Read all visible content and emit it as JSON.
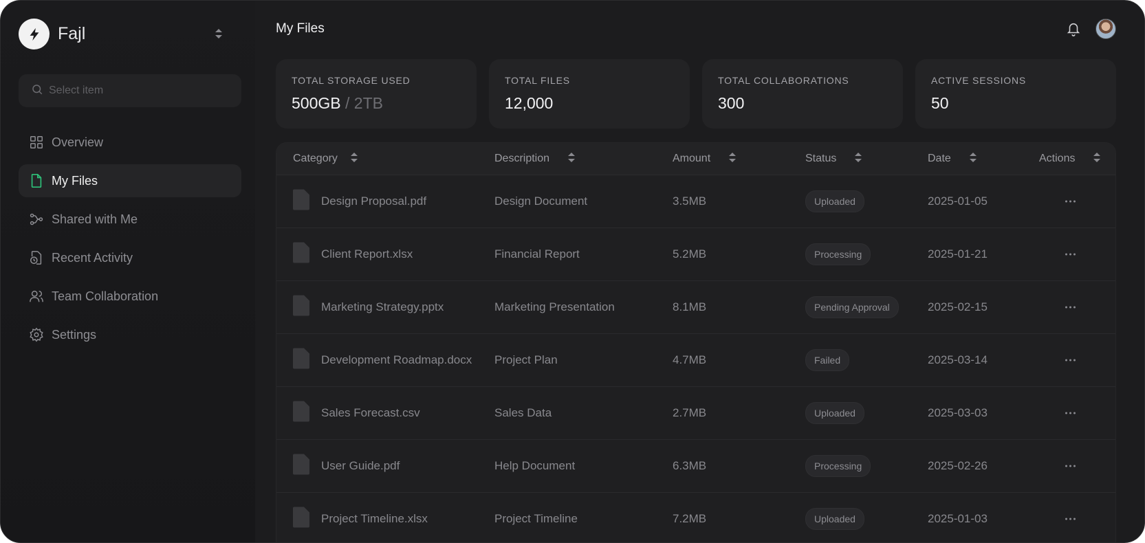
{
  "brand": {
    "name": "Fajl"
  },
  "search": {
    "placeholder": "Select item"
  },
  "nav": [
    {
      "label": "Overview",
      "icon": "grid-icon",
      "active": false
    },
    {
      "label": "My Files",
      "icon": "file-icon",
      "active": true
    },
    {
      "label": "Shared with Me",
      "icon": "share-icon",
      "active": false
    },
    {
      "label": "Recent Activity",
      "icon": "clock-file-icon",
      "active": false
    },
    {
      "label": "Team Collaboration",
      "icon": "users-icon",
      "active": false
    },
    {
      "label": "Settings",
      "icon": "gear-icon",
      "active": false
    }
  ],
  "header": {
    "title": "My Files"
  },
  "stats": [
    {
      "label": "TOTAL STORAGE USED",
      "value": "500GB",
      "suffix": " / 2TB"
    },
    {
      "label": "TOTAL FILES",
      "value": "12,000",
      "suffix": ""
    },
    {
      "label": "TOTAL COLLABORATIONS",
      "value": "300",
      "suffix": ""
    },
    {
      "label": "ACTIVE SESSIONS",
      "value": "50",
      "suffix": ""
    }
  ],
  "table": {
    "columns": [
      "Category",
      "Description",
      "Amount",
      "Status",
      "Date",
      "Actions"
    ],
    "rows": [
      {
        "name": "Design Proposal.pdf",
        "description": "Design Document",
        "amount": "3.5MB",
        "status": "Uploaded",
        "date": "2025-01-05"
      },
      {
        "name": "Client Report.xlsx",
        "description": "Financial Report",
        "amount": "5.2MB",
        "status": "Processing",
        "date": "2025-01-21"
      },
      {
        "name": "Marketing Strategy.pptx",
        "description": "Marketing Presentation",
        "amount": "8.1MB",
        "status": "Pending Approval",
        "date": "2025-02-15"
      },
      {
        "name": "Development Roadmap.docx",
        "description": "Project Plan",
        "amount": "4.7MB",
        "status": "Failed",
        "date": "2025-03-14"
      },
      {
        "name": "Sales Forecast.csv",
        "description": "Sales Data",
        "amount": "2.7MB",
        "status": "Uploaded",
        "date": "2025-03-03"
      },
      {
        "name": "User Guide.pdf",
        "description": "Help Document",
        "amount": "6.3MB",
        "status": "Processing",
        "date": "2025-02-26"
      },
      {
        "name": "Project Timeline.xlsx",
        "description": "Project Timeline",
        "amount": "7.2MB",
        "status": "Uploaded",
        "date": "2025-01-03"
      }
    ]
  },
  "colors": {
    "accent": "#2fc27a",
    "background": "#1c1c1e"
  }
}
